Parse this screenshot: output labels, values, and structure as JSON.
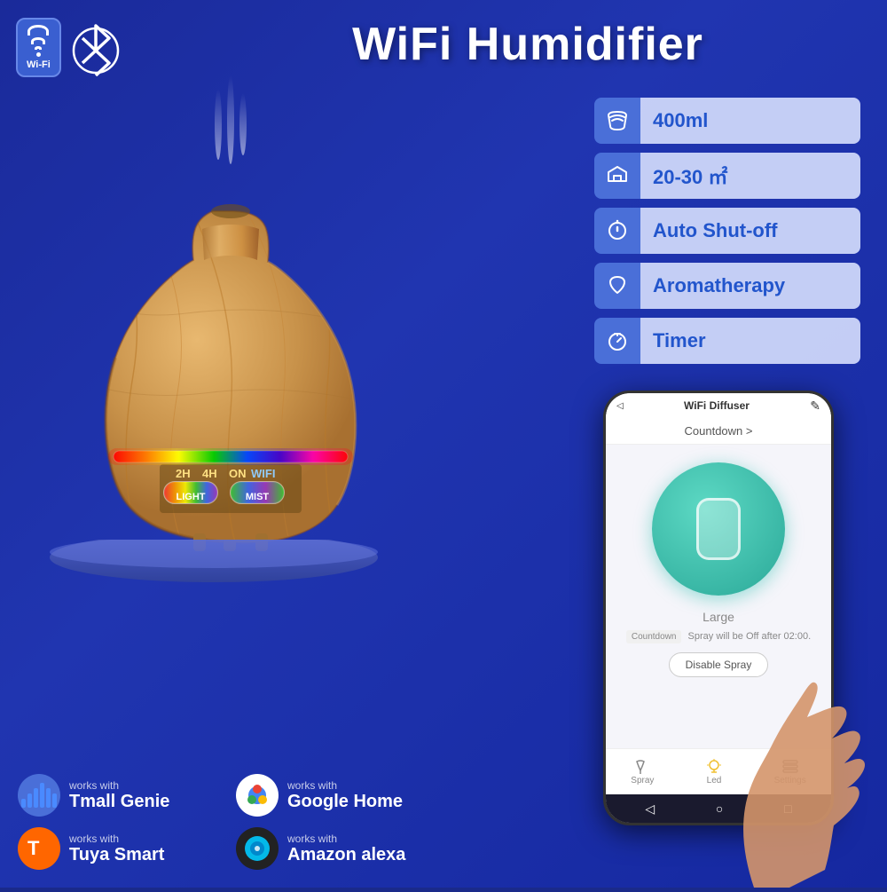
{
  "page": {
    "background": "#1a2ab0",
    "title": "WiFi Humidifier"
  },
  "header": {
    "wifi_label": "Wi-Fi",
    "title": "WiFi Humidifier"
  },
  "features": [
    {
      "id": "capacity",
      "label": "400ml",
      "icon": "water-wave"
    },
    {
      "id": "area",
      "label": "20-30 ㎡",
      "icon": "home"
    },
    {
      "id": "shutoff",
      "label": "Auto Shut-off",
      "icon": "power"
    },
    {
      "id": "aromatherapy",
      "label": "Aromatherapy",
      "icon": "drop"
    },
    {
      "id": "timer",
      "label": "Timer",
      "icon": "clock"
    }
  ],
  "controls": {
    "timer_2h": "2H",
    "timer_4h": "4H",
    "timer_on": "ON",
    "timer_wifi": "WIFI",
    "btn_light": "LIGHT",
    "btn_mist": "MIST"
  },
  "partners": [
    {
      "id": "tmall",
      "works_with": "works with",
      "name": "Tmall Genie"
    },
    {
      "id": "google",
      "works_with": "works with",
      "name": "Google Home"
    },
    {
      "id": "tuya",
      "works_with": "works with",
      "name": "Tuya Smart"
    },
    {
      "id": "amazon",
      "works_with": "works with",
      "name": "Amazon alexa"
    }
  ],
  "phone": {
    "app_title": "WiFi Diffuser",
    "countdown_label": "Countdown >",
    "size_label": "Large",
    "spray_status": "Spray will be Off after 02:00.",
    "countdown_prefix": "Countdown",
    "disable_btn": "Disable Spray",
    "nav_spray": "Spray",
    "nav_led": "Led",
    "nav_settings": "Settings"
  }
}
